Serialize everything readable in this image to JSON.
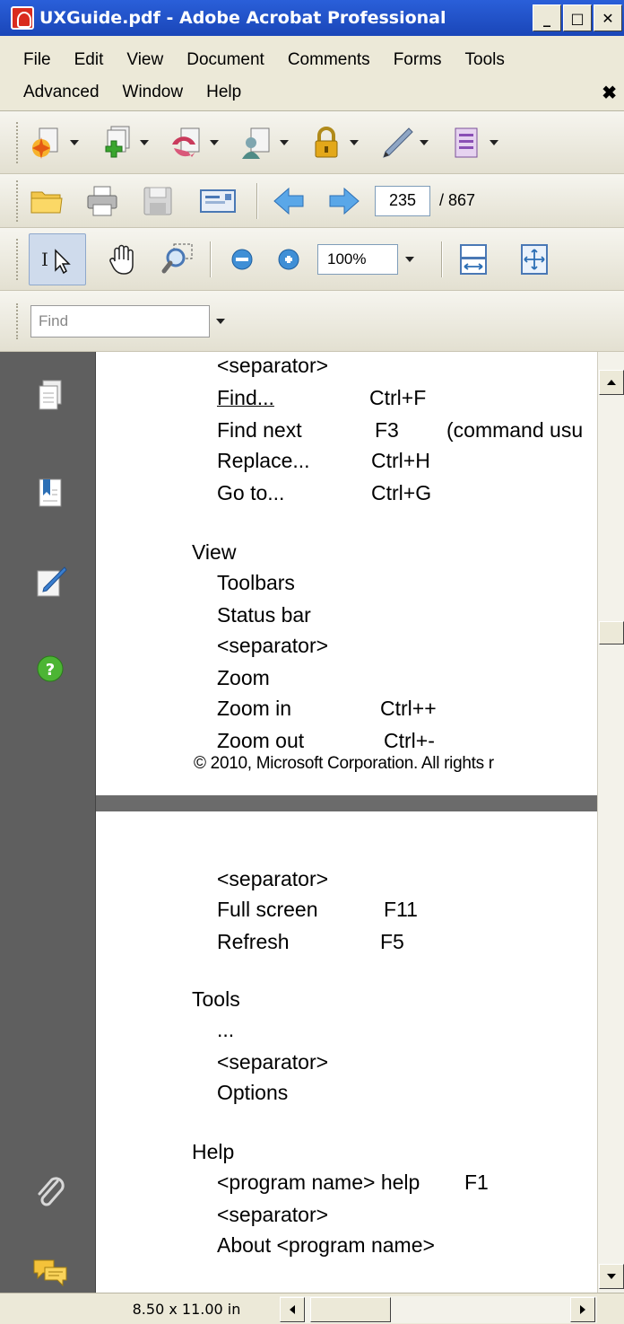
{
  "window": {
    "title": "UXGuide.pdf - Adobe Acrobat Professional",
    "minimize_label": "_",
    "maximize_label": "□",
    "close_label": "✕"
  },
  "menu": {
    "row1": [
      "File",
      "Edit",
      "View",
      "Document",
      "Comments",
      "Forms",
      "Tools"
    ],
    "row2": [
      "Advanced",
      "Window",
      "Help"
    ],
    "close_label": "✖"
  },
  "toolbar_tasks": {
    "icons": [
      "create-pdf-icon",
      "combine-files-icon",
      "export-icon",
      "collaborate-icon",
      "secure-lock-icon",
      "sign-pen-icon",
      "forms-icon"
    ]
  },
  "toolbar_file": {
    "icons": [
      "open-folder-icon",
      "print-icon",
      "save-icon",
      "email-icon",
      "previous-page-icon",
      "next-page-icon"
    ],
    "current_page": "235",
    "total_pages": "/ 867"
  },
  "toolbar_tools": {
    "icons": [
      "select-tool-icon",
      "hand-tool-icon",
      "zoom-marquee-icon",
      "zoom-out-icon",
      "zoom-in-icon",
      "fit-width-icon",
      "fit-page-icon"
    ],
    "zoom_value": "100%"
  },
  "find": {
    "placeholder": "Find"
  },
  "navpane": {
    "icons": [
      "pages-icon",
      "bookmarks-icon",
      "signatures-icon",
      "help-icon",
      "attachments-icon",
      "comments-icon"
    ]
  },
  "document": {
    "page1": {
      "lines": [
        "<separator>",
        "Find...",
        "Find next",
        "Replace...",
        "Go to...",
        "View",
        "Toolbars",
        "Status bar",
        "<separator>",
        "Zoom",
        "Zoom in",
        "Zoom out"
      ],
      "shortcuts": [
        "Ctrl+F",
        "F3",
        "(command usu",
        "Ctrl+H",
        "Ctrl+G",
        "Ctrl++",
        "Ctrl+-"
      ],
      "copyright": "© 2010, Microsoft Corporation. All rights r"
    },
    "page2": {
      "lines": [
        "<separator>",
        "Full screen",
        "Refresh",
        "Tools",
        "...",
        "<separator>",
        "Options",
        "Help",
        "<program name> help",
        "<separator>",
        "About <program name>"
      ],
      "shortcuts": [
        "F11",
        "F5",
        "F1"
      ]
    }
  },
  "status": {
    "page_size": "8.50 x 11.00 in"
  }
}
